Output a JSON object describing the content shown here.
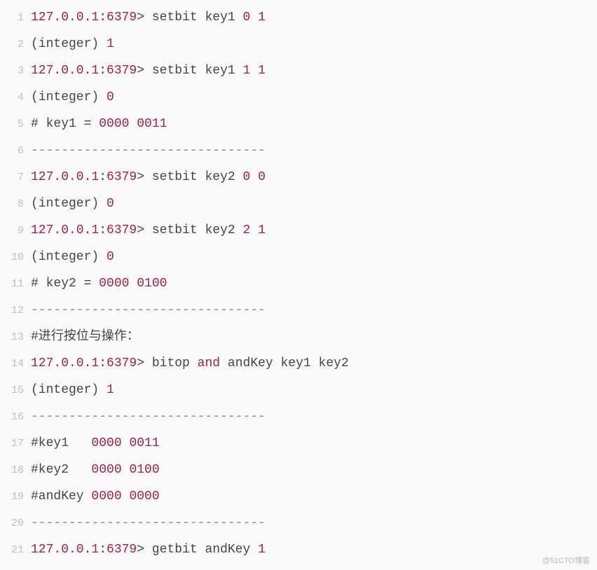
{
  "watermark": "@51CTO博客",
  "lines": [
    {
      "n": "1",
      "segs": [
        {
          "t": "127.0.0.1",
          "c": "prompt"
        },
        {
          "t": ":",
          "c": ""
        },
        {
          "t": "6379",
          "c": "prompt"
        },
        {
          "t": "> setbit key1 ",
          "c": ""
        },
        {
          "t": "0",
          "c": "num"
        },
        {
          "t": " ",
          "c": ""
        },
        {
          "t": "1",
          "c": "num"
        }
      ]
    },
    {
      "n": "2",
      "segs": [
        {
          "t": "(integer) ",
          "c": ""
        },
        {
          "t": "1",
          "c": "num"
        }
      ]
    },
    {
      "n": "3",
      "segs": [
        {
          "t": "127.0.0.1",
          "c": "prompt"
        },
        {
          "t": ":",
          "c": ""
        },
        {
          "t": "6379",
          "c": "prompt"
        },
        {
          "t": "> setbit key1 ",
          "c": ""
        },
        {
          "t": "1",
          "c": "num"
        },
        {
          "t": " ",
          "c": ""
        },
        {
          "t": "1",
          "c": "num"
        }
      ]
    },
    {
      "n": "4",
      "segs": [
        {
          "t": "(integer) ",
          "c": ""
        },
        {
          "t": "0",
          "c": "num"
        }
      ]
    },
    {
      "n": "5",
      "segs": [
        {
          "t": "# key1 = ",
          "c": ""
        },
        {
          "t": "0000",
          "c": "num"
        },
        {
          "t": " ",
          "c": ""
        },
        {
          "t": "0011",
          "c": "num"
        }
      ]
    },
    {
      "n": "6",
      "segs": [
        {
          "t": "-------------------------------",
          "c": "dash"
        }
      ]
    },
    {
      "n": "7",
      "segs": [
        {
          "t": "127.0.0.1",
          "c": "prompt"
        },
        {
          "t": ":",
          "c": ""
        },
        {
          "t": "6379",
          "c": "prompt"
        },
        {
          "t": "> setbit key2 ",
          "c": ""
        },
        {
          "t": "0",
          "c": "num"
        },
        {
          "t": " ",
          "c": ""
        },
        {
          "t": "0",
          "c": "num"
        }
      ]
    },
    {
      "n": "8",
      "segs": [
        {
          "t": "(integer) ",
          "c": ""
        },
        {
          "t": "0",
          "c": "num"
        }
      ]
    },
    {
      "n": "9",
      "segs": [
        {
          "t": "127.0.0.1",
          "c": "prompt"
        },
        {
          "t": ":",
          "c": ""
        },
        {
          "t": "6379",
          "c": "prompt"
        },
        {
          "t": "> setbit key2 ",
          "c": ""
        },
        {
          "t": "2",
          "c": "num"
        },
        {
          "t": " ",
          "c": ""
        },
        {
          "t": "1",
          "c": "num"
        }
      ]
    },
    {
      "n": "10",
      "segs": [
        {
          "t": "(integer) ",
          "c": ""
        },
        {
          "t": "0",
          "c": "num"
        }
      ]
    },
    {
      "n": "11",
      "segs": [
        {
          "t": "# key2 = ",
          "c": ""
        },
        {
          "t": "0000",
          "c": "num"
        },
        {
          "t": " ",
          "c": ""
        },
        {
          "t": "0100",
          "c": "num"
        }
      ]
    },
    {
      "n": "12",
      "segs": [
        {
          "t": "-------------------------------",
          "c": "dash"
        }
      ]
    },
    {
      "n": "13",
      "segs": [
        {
          "t": "#进行按位与操作：",
          "c": ""
        }
      ]
    },
    {
      "n": "14",
      "segs": [
        {
          "t": "127.0.0.1",
          "c": "prompt"
        },
        {
          "t": ":",
          "c": ""
        },
        {
          "t": "6379",
          "c": "prompt"
        },
        {
          "t": "> bitop ",
          "c": ""
        },
        {
          "t": "and",
          "c": "prompt"
        },
        {
          "t": " ",
          "c": ""
        },
        {
          "t": "andKey key1 key2",
          "c": ""
        }
      ]
    },
    {
      "n": "15",
      "segs": [
        {
          "t": "(integer) ",
          "c": ""
        },
        {
          "t": "1",
          "c": "num"
        }
      ]
    },
    {
      "n": "16",
      "segs": [
        {
          "t": "-------------------------------",
          "c": "dash"
        }
      ]
    },
    {
      "n": "17",
      "segs": [
        {
          "t": "#key1   ",
          "c": ""
        },
        {
          "t": "0000",
          "c": "num"
        },
        {
          "t": " ",
          "c": ""
        },
        {
          "t": "0011",
          "c": "num"
        }
      ]
    },
    {
      "n": "18",
      "segs": [
        {
          "t": "#key2   ",
          "c": ""
        },
        {
          "t": "0000",
          "c": "num"
        },
        {
          "t": " ",
          "c": ""
        },
        {
          "t": "0100",
          "c": "num"
        }
      ]
    },
    {
      "n": "19",
      "segs": [
        {
          "t": "#andKey ",
          "c": ""
        },
        {
          "t": "0000",
          "c": "num"
        },
        {
          "t": " ",
          "c": ""
        },
        {
          "t": "0000",
          "c": "num"
        }
      ]
    },
    {
      "n": "20",
      "segs": [
        {
          "t": "-------------------------------",
          "c": "dash"
        }
      ]
    },
    {
      "n": "21",
      "segs": [
        {
          "t": "127.0.0.1",
          "c": "prompt"
        },
        {
          "t": ":",
          "c": ""
        },
        {
          "t": "6379",
          "c": "prompt"
        },
        {
          "t": "> getbit andKey ",
          "c": ""
        },
        {
          "t": "1",
          "c": "num"
        }
      ]
    }
  ]
}
